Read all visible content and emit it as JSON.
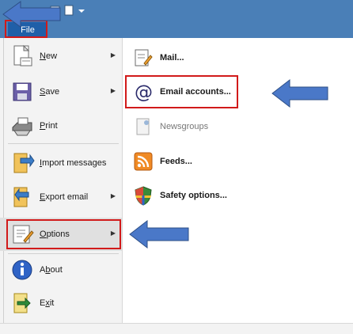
{
  "file_tab": "File",
  "left_menu": [
    {
      "id": "new",
      "label": "New",
      "accel": "N",
      "has_submenu": true,
      "icon": "new-document-icon"
    },
    {
      "id": "save",
      "label": "Save",
      "accel": "S",
      "has_submenu": true,
      "icon": "floppy-disk-icon"
    },
    {
      "id": "print",
      "label": "Print",
      "accel": "P",
      "has_submenu": false,
      "icon": "printer-icon"
    },
    {
      "id": "import",
      "label": "Import messages",
      "accel": "I",
      "has_submenu": false,
      "icon": "import-icon"
    },
    {
      "id": "export",
      "label": "Export email",
      "accel": "E",
      "has_submenu": true,
      "icon": "export-icon"
    },
    {
      "id": "options",
      "label": "Options",
      "accel": "O",
      "has_submenu": true,
      "icon": "options-icon",
      "selected": true
    },
    {
      "id": "about",
      "label": "About",
      "accel": "b",
      "has_submenu": false,
      "icon": "info-icon"
    },
    {
      "id": "exit",
      "label": "Exit",
      "accel": "x",
      "has_submenu": false,
      "icon": "exit-icon"
    }
  ],
  "right_menu": [
    {
      "id": "mail",
      "label": "Mail...",
      "icon": "mail-options-icon",
      "enabled": true
    },
    {
      "id": "email_accounts",
      "label": "Email accounts...",
      "icon": "at-sign-icon",
      "enabled": true,
      "highlighted": true
    },
    {
      "id": "newsgroups",
      "label": "Newsgroups",
      "icon": "newsgroups-icon",
      "enabled": false
    },
    {
      "id": "feeds",
      "label": "Feeds...",
      "icon": "rss-feed-icon",
      "enabled": true
    },
    {
      "id": "safety",
      "label": "Safety options...",
      "icon": "shield-icon",
      "enabled": true
    }
  ],
  "colors": {
    "accent": "#1f5fa8",
    "titlebar": "#4a7fb7",
    "highlight_outline": "#d11a1a",
    "callout_arrow": "#4a78c8"
  }
}
